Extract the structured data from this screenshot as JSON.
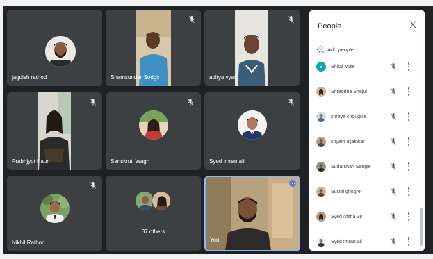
{
  "tiles": [
    {
      "name": "jagdish rathod"
    },
    {
      "name": "Shamsundar Sodgir"
    },
    {
      "name": "aditya vyas"
    },
    {
      "name": "Prabhjyot Kaur"
    },
    {
      "name": "Sanskruti Wagh"
    },
    {
      "name": "Syed imran ali"
    },
    {
      "name": "Nikhil Rathod"
    },
    {
      "name": "37 others"
    },
    {
      "name": "You"
    }
  ],
  "panel": {
    "title": "People",
    "close": "X",
    "add_people": "Add people",
    "participants": [
      {
        "name": "Shital Mule",
        "initial": "S"
      },
      {
        "name": "Shraddha Shejul"
      },
      {
        "name": "shreya chougule"
      },
      {
        "name": "shyam ujjainkar"
      },
      {
        "name": "Sudarshan Sangle"
      },
      {
        "name": "Sushil ghogre"
      },
      {
        "name": "Syed Afsha 38"
      },
      {
        "name": "Syed Imran ali"
      }
    ]
  },
  "colors": {
    "tile_bg": "#3c4043",
    "stage_bg": "#202124",
    "active_speaker": "#8ab4f8",
    "avatar_teal": "#12a4af"
  }
}
